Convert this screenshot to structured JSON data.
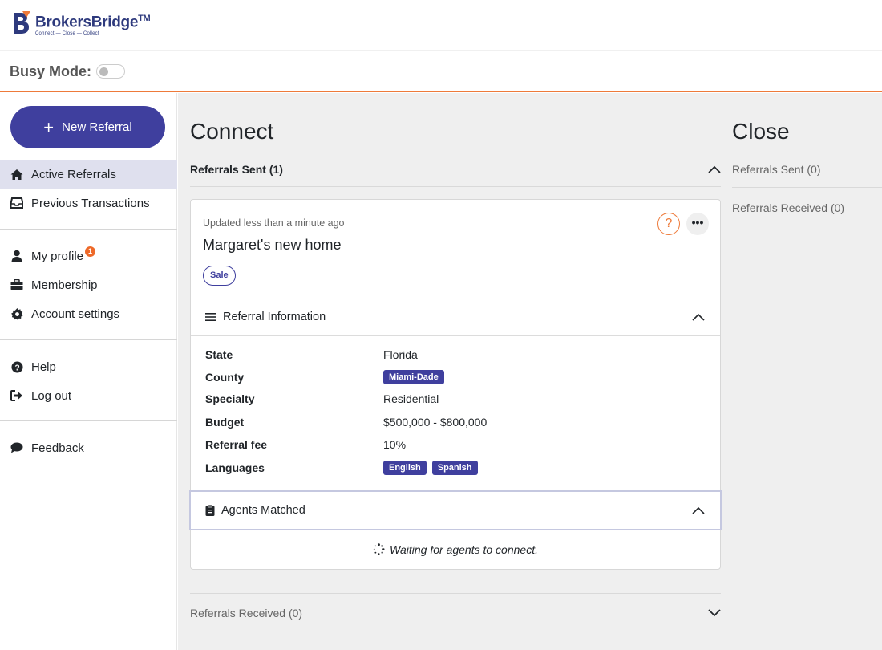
{
  "brand": {
    "name": "BrokersBridge",
    "tm": "TM",
    "tagline": "Connect — Close — Collect"
  },
  "busy_mode": {
    "label": "Busy Mode:",
    "enabled": false
  },
  "sidebar": {
    "new_referral": "New Referral",
    "items": [
      {
        "label": "Active Referrals",
        "icon": "home-icon",
        "active": true
      },
      {
        "label": "Previous Transactions",
        "icon": "inbox-icon",
        "active": false
      },
      {
        "label": "My profile",
        "icon": "user-icon",
        "badge": "1"
      },
      {
        "label": "Membership",
        "icon": "briefcase-icon"
      },
      {
        "label": "Account settings",
        "icon": "gear-icon"
      },
      {
        "label": "Help",
        "icon": "question-circle-icon"
      },
      {
        "label": "Log out",
        "icon": "logout-icon"
      },
      {
        "label": "Feedback",
        "icon": "chat-bubble-icon"
      }
    ]
  },
  "connect": {
    "title": "Connect",
    "referrals_sent": "Referrals Sent (1)",
    "referrals_received": "Referrals Received (0)",
    "card": {
      "updated": "Updated less than a minute ago",
      "title": "Margaret's new home",
      "tag": "Sale",
      "help": "?",
      "more": "•••",
      "info_header": "Referral Information",
      "info": {
        "state_key": "State",
        "state_val": "Florida",
        "county_key": "County",
        "county_val": "Miami-Dade",
        "specialty_key": "Specialty",
        "specialty_val": "Residential",
        "budget_key": "Budget",
        "budget_val": "$500,000 - $800,000",
        "fee_key": "Referral fee",
        "fee_val": "10%",
        "languages_key": "Languages",
        "languages": [
          "English",
          "Spanish"
        ]
      },
      "agents_header": "Agents Matched",
      "waiting": "Waiting for agents to connect."
    }
  },
  "close": {
    "title": "Close",
    "referrals_sent": "Referrals Sent (0)",
    "referrals_received": "Referrals Received (0)"
  },
  "colors": {
    "primary": "#3f3f9e",
    "accent": "#ee7a3a",
    "background": "#efefef"
  }
}
